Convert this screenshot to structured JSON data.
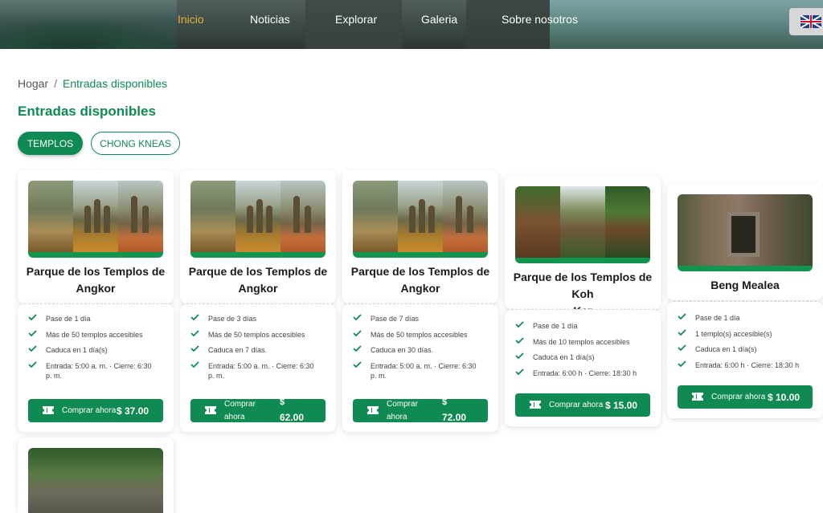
{
  "nav": {
    "items": [
      {
        "label": "Inicio",
        "active": true
      },
      {
        "label": "Noticias",
        "active": false
      },
      {
        "label": "Explorar",
        "active": false
      },
      {
        "label": "Galeria",
        "active": false
      },
      {
        "label": "Sobre nosotros",
        "active": false
      }
    ],
    "language_flag": "uk-flag-icon"
  },
  "breadcrumb": {
    "home": "Hogar",
    "separator": "/",
    "current": "Entradas disponibles"
  },
  "page_title": "Entradas disponibles",
  "tabs": [
    {
      "label": "TEMPLOS",
      "active": true
    },
    {
      "label": "CHONG KNEAS",
      "active": false
    }
  ],
  "colors": {
    "accent": "#0f8a52",
    "nav_active": "#e0b63a"
  },
  "cards": [
    {
      "name_line1": "Parque de los Templos de",
      "name_line2": "Angkor",
      "features": [
        "Pase de 1 día",
        "Más de 50 templos accesibles",
        "Caduca en 1 día(s)",
        "Entrada: 5:00 a. m. · Cierre: 6:30",
        "p. m."
      ],
      "buy_label": "Comprar ahora",
      "price": "$ 37.00"
    },
    {
      "name_line1": "Parque de los Templos de",
      "name_line2": "Angkor",
      "features": [
        "Pase de 3 días",
        "Más de 50 templos accesibles",
        "Caduca en 7 días.",
        "Entrada: 5:00 a. m. · Cierre: 6:30",
        "p. m."
      ],
      "buy_label_1": "Comprar",
      "buy_label_2": "ahora",
      "price_1": "$",
      "price_2": "62.00"
    },
    {
      "name_line1": "Parque de los Templos de",
      "name_line2": "Angkor",
      "features": [
        "Pase de 7 días",
        "Más de 50 templos accesibles",
        "Caduca en 30 días.",
        "Entrada: 5:00 a. m. · Cierre: 6:30",
        "p. m."
      ],
      "buy_label_1": "Comprar",
      "buy_label_2": "ahora",
      "price_1": "$",
      "price_2": "72.00"
    },
    {
      "name_line1": "Parque de los Templos de Koh",
      "name_line2": "Ker",
      "features": [
        "Pase de 1 día",
        "Más de 10 templos accesibles",
        "Caduca en 1 día(s)",
        "Entrada: 6:00 h · Cierre: 18:30 h"
      ],
      "buy_label": "Comprar ahora",
      "price": "$ 15.00"
    },
    {
      "name_line1": "Beng Mealea",
      "features": [
        "Pase de 1 día",
        "1 templo(s) accesible(s)",
        "Caduca en 1 día(s)",
        "Entrada: 6:00 h · Cierre: 18:30 h"
      ],
      "buy_label": "Comprar ahora",
      "price": "$ 10.00"
    }
  ]
}
